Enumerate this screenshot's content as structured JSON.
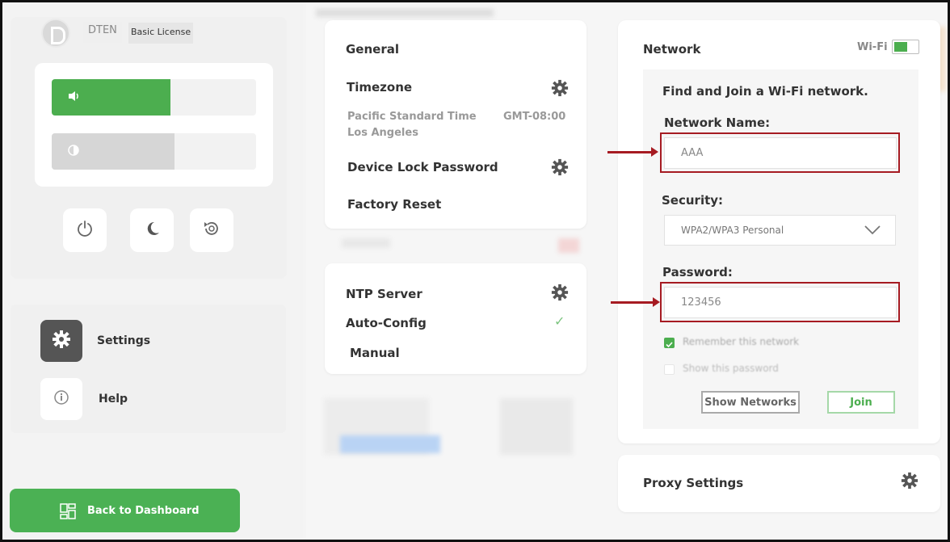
{
  "header": {
    "brand": "DTEN",
    "license": "Basic License"
  },
  "controls": {
    "volume": {
      "icon": "speaker-icon",
      "level": 0.58
    },
    "brightness": {
      "icon": "brightness-icon",
      "level": 0.6
    },
    "quick_buttons": [
      "power-icon",
      "moon-icon",
      "restart-icon"
    ]
  },
  "sidebar": {
    "items": [
      {
        "label": "Settings",
        "icon": "gear-icon",
        "active": true
      },
      {
        "label": "Help",
        "icon": "info-icon",
        "active": false
      }
    ],
    "back_label": "Back to Dashboard"
  },
  "general": {
    "heading": "General",
    "timezone_label": "Timezone",
    "timezone_value": "Pacific Standard Time",
    "timezone_city": "Los Angeles",
    "timezone_offset": "GMT-08:00",
    "lock_label": "Device Lock Password",
    "reset_label": "Factory Reset"
  },
  "ntp": {
    "heading": "NTP Server",
    "auto_label": "Auto-Config",
    "manual_label": "Manual",
    "check": "✓"
  },
  "network": {
    "heading": "Network",
    "wifi_label": "Wi-Fi",
    "wifi_on": true,
    "find_text": "Find and Join a Wi-Fi network.",
    "name_label": "Network Name:",
    "name_value": "AAA",
    "security_label": "Security:",
    "security_value": "WPA2/WPA3 Personal",
    "password_label": "Password:",
    "password_value": "123456",
    "remember_label": "Remember this network",
    "show_password_label": "Show this password",
    "show_networks_label": "Show Networks",
    "join_label": "Join"
  },
  "proxy": {
    "heading": "Proxy Settings"
  },
  "colors": {
    "accent": "#4cae4f",
    "highlight": "#a61b22"
  }
}
